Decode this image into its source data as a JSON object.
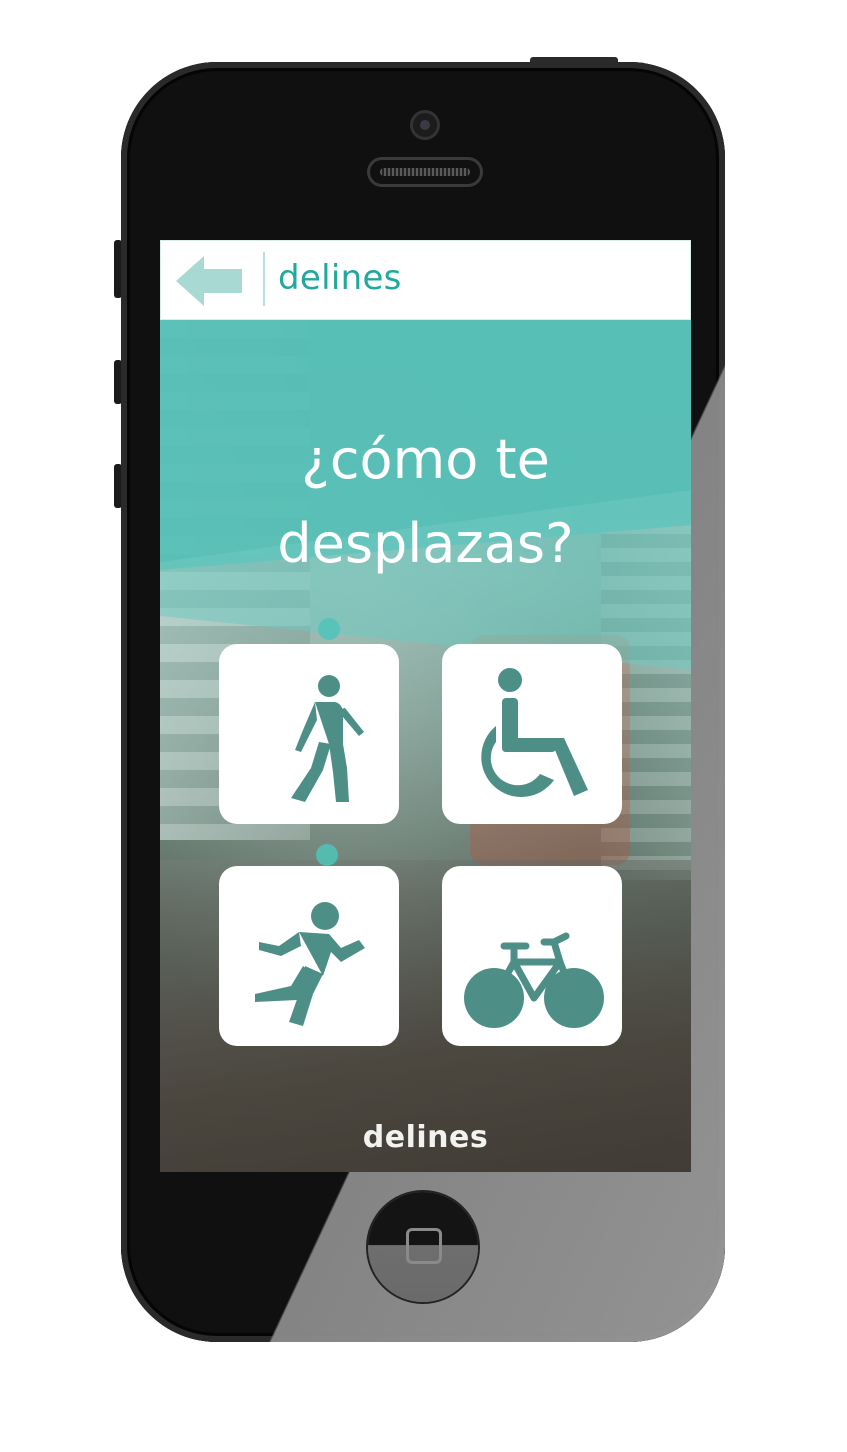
{
  "header": {
    "title": "delines",
    "back_icon": "arrow-left-icon"
  },
  "main": {
    "question_line1": "¿cómo te",
    "question_line2": "desplazas?",
    "options": [
      {
        "id": "walk",
        "icon": "walking-person-icon"
      },
      {
        "id": "wheelchair",
        "icon": "wheelchair-icon"
      },
      {
        "id": "run",
        "icon": "running-person-icon"
      },
      {
        "id": "bike",
        "icon": "bicycle-icon"
      }
    ]
  },
  "footer": {
    "logo_text": "delines"
  },
  "colors": {
    "accent": "#22a89c",
    "teal_overlay": "#55bfb6",
    "icon_fill": "#4d8f87"
  }
}
